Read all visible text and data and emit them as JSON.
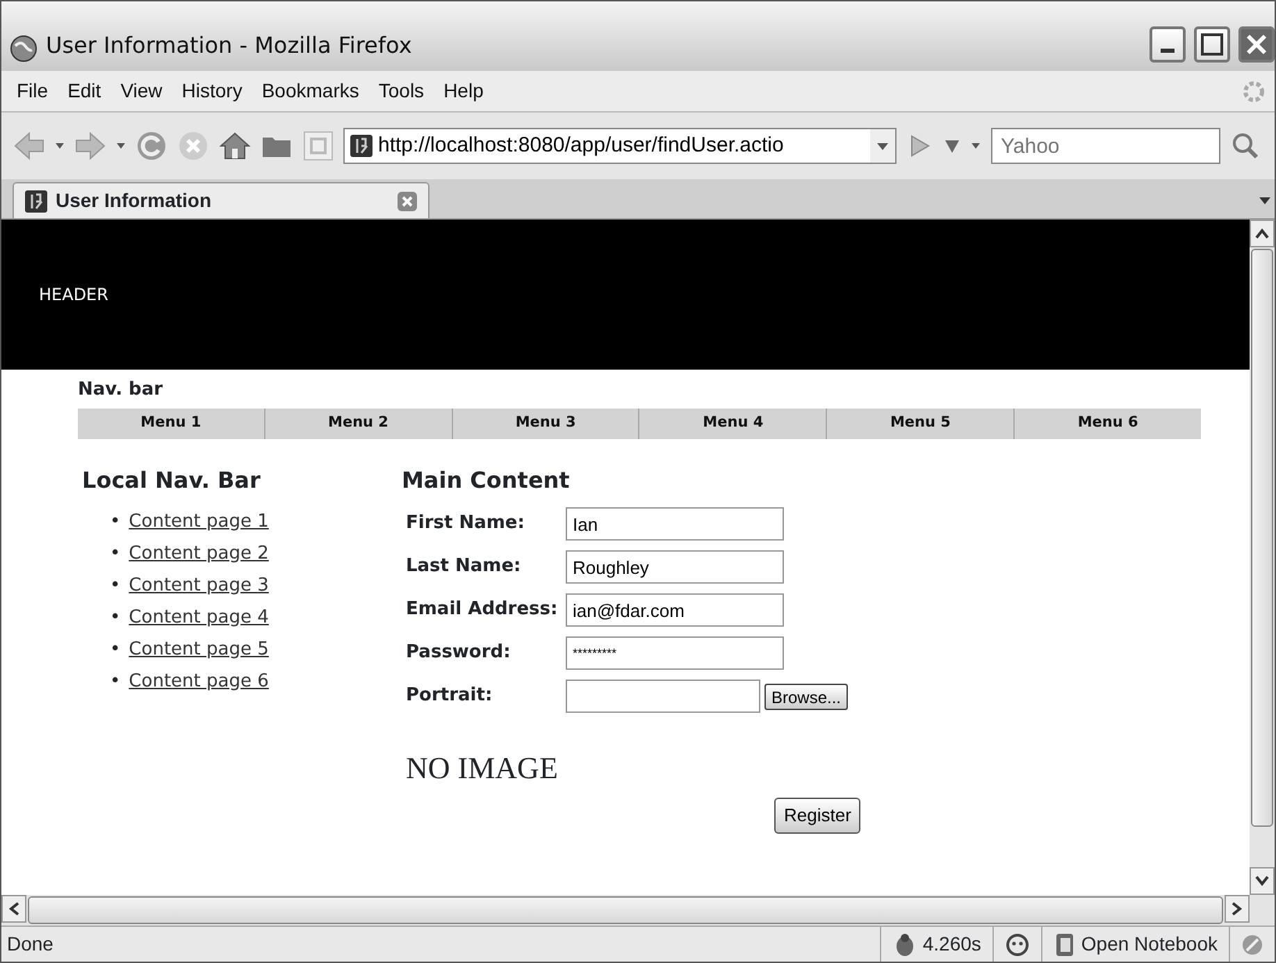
{
  "window": {
    "title": "User Information - Mozilla Firefox"
  },
  "menu_bar": [
    "File",
    "Edit",
    "View",
    "History",
    "Bookmarks",
    "Tools",
    "Help"
  ],
  "toolbar": {
    "url": "http://localhost:8080/app/user/findUser.actio",
    "search_placeholder": "Yahoo"
  },
  "tabs": [
    {
      "label": "User Information",
      "selected": true
    }
  ],
  "page": {
    "header": "HEADER",
    "nav_bar_title": "Nav. bar",
    "nav_menus": [
      "Menu 1",
      "Menu 2",
      "Menu 3",
      "Menu 4",
      "Menu 5",
      "Menu 6"
    ],
    "local_nav": {
      "title": "Local Nav. Bar",
      "links": [
        {
          "bullet": "•",
          "text": "Content page 1"
        },
        {
          "bullet": "•",
          "text": "Content page 2"
        },
        {
          "bullet": "•",
          "text": "Content page 3"
        },
        {
          "bullet": "•",
          "text": "Content page 4"
        },
        {
          "bullet": "•",
          "text": "Content page 5"
        },
        {
          "bullet": "•",
          "text": "Content page 6"
        }
      ]
    },
    "main": {
      "title": "Main Content",
      "fields": [
        {
          "label": "First Name:",
          "kind": "text",
          "value": "Ian"
        },
        {
          "label": "Last Name:",
          "kind": "text",
          "value": "Roughley"
        },
        {
          "label": "Email Address:",
          "kind": "text",
          "value": "ian@fdar.com"
        },
        {
          "label": "Password:",
          "kind": "password",
          "value": "*********"
        },
        {
          "label": "Portrait:",
          "kind": "file",
          "button": "Browse..."
        }
      ],
      "image_text": "NO IMAGE",
      "submit": "Register"
    }
  },
  "status_bar": {
    "text": "Done",
    "timing": "4.260s",
    "notebook": "Open Notebook"
  }
}
